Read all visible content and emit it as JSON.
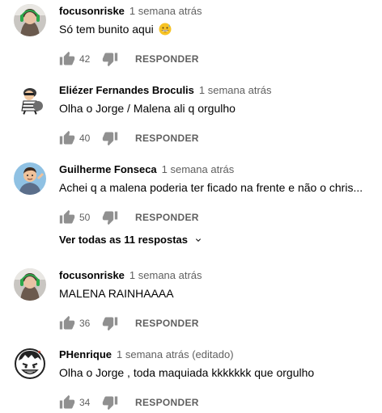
{
  "comments": [
    {
      "author": "focusonriske",
      "time": "1 semana atrás",
      "text": "Só tem bunito aqui",
      "emoji": "grinning-sweat-emoji",
      "likes": "42",
      "reply_label": "RESPONDER",
      "avatar": "woman-headphones-avatar"
    },
    {
      "author": "Eliézer Fernandes Broculis",
      "time": "1 semana atrás",
      "text": "Olha o Jorge / Malena ali  q orgulho",
      "likes": "40",
      "reply_label": "RESPONDER",
      "avatar": "cartoon-thief-avatar"
    },
    {
      "author": "Guilherme Fonseca",
      "time": "1 semana atrás",
      "text": "Achei q a malena poderia ter ficado na frente e não o chris...",
      "likes": "50",
      "reply_label": "RESPONDER",
      "avatar": "cartoon-man-avatar"
    },
    {
      "author": "focusonriske",
      "time": "1 semana atrás",
      "text": "MALENA RAINHAAAA",
      "likes": "36",
      "reply_label": "RESPONDER",
      "avatar": "woman-headphones-avatar"
    },
    {
      "author": "PHenrique",
      "time": "1 semana atrás (editado)",
      "text": "Olha o Jorge , toda maquiada kkkkkkk que orgulho",
      "likes": "34",
      "reply_label": "RESPONDER",
      "avatar": "cartoon-grin-avatar"
    }
  ],
  "view_replies": "Ver todas as 11 respostas",
  "colors": {
    "text_primary": "#030303",
    "text_secondary": "#606060",
    "icon": "#909090"
  }
}
